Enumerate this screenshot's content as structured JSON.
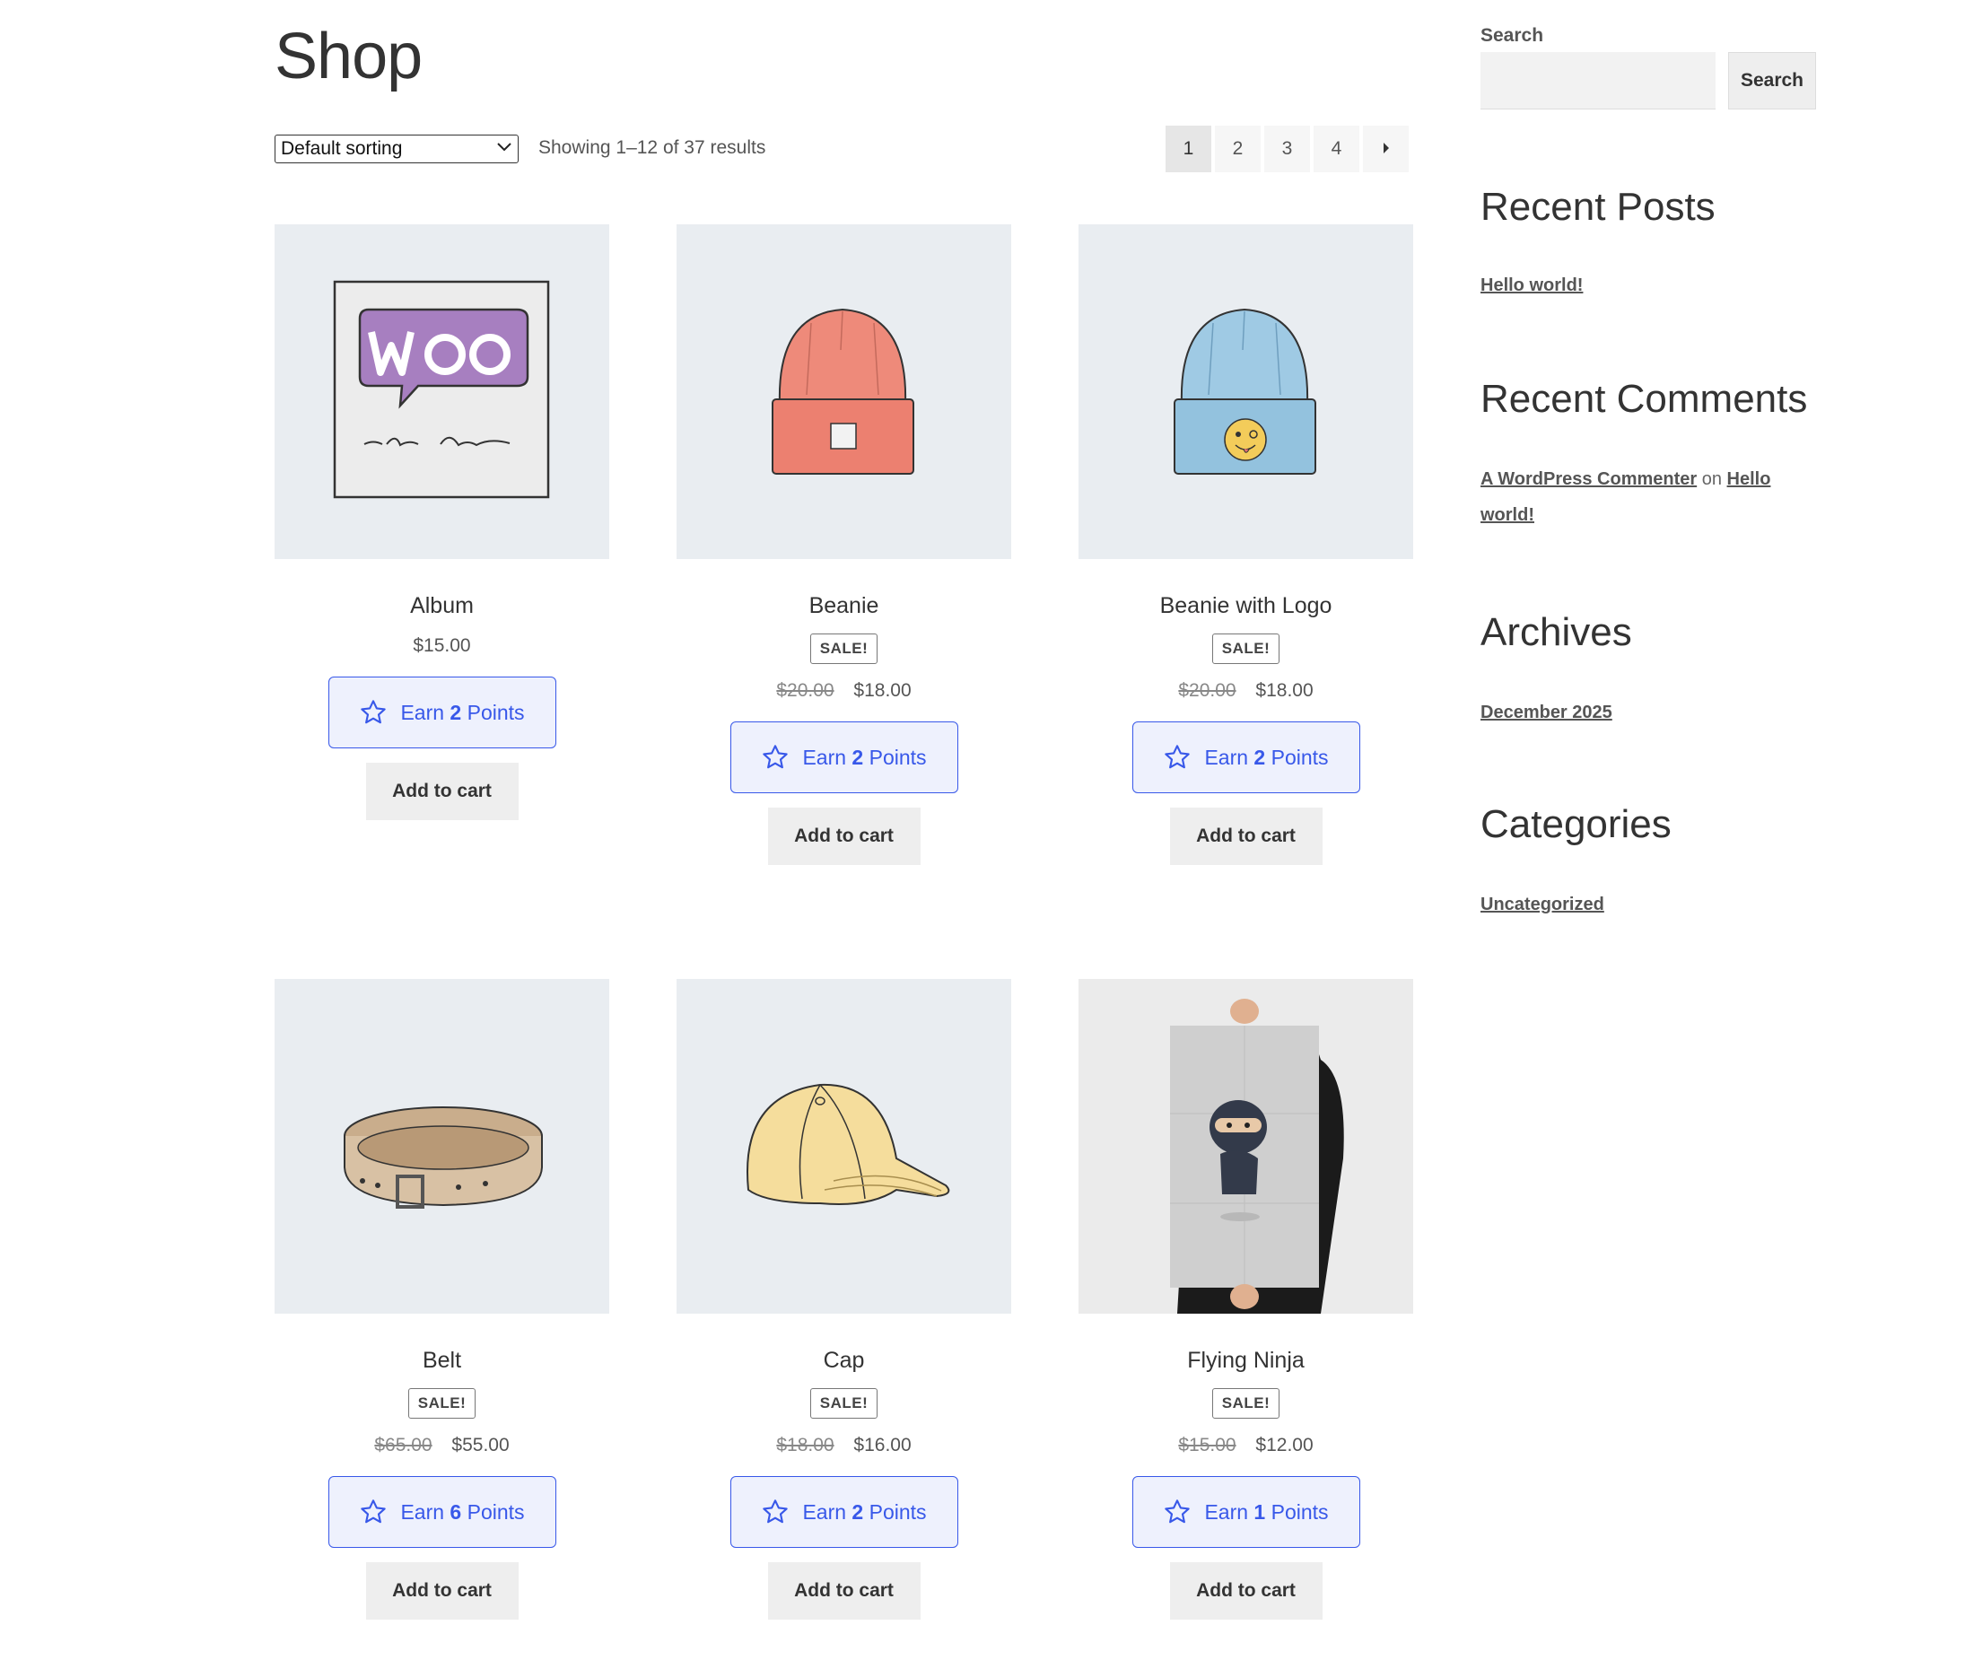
{
  "page": {
    "title": "Shop"
  },
  "toolbar": {
    "sorting": "Default sorting",
    "result_count": "Showing 1–12 of 37 results",
    "pages": [
      "1",
      "2",
      "3",
      "4"
    ],
    "current_page": "1"
  },
  "products": [
    {
      "name": "Album",
      "sale": "",
      "old_price": "",
      "price": "$15.00",
      "earn_prefix": "Earn",
      "points": "2",
      "earn_suffix": "Points",
      "cart": "Add to cart",
      "image": "woo-album"
    },
    {
      "name": "Beanie",
      "sale": "SALE!",
      "old_price": "$20.00",
      "price": "$18.00",
      "earn_prefix": "Earn",
      "points": "2",
      "earn_suffix": "Points",
      "cart": "Add to cart",
      "image": "red-beanie"
    },
    {
      "name": "Beanie with Logo",
      "sale": "SALE!",
      "old_price": "$20.00",
      "price": "$18.00",
      "earn_prefix": "Earn",
      "points": "2",
      "earn_suffix": "Points",
      "cart": "Add to cart",
      "image": "blue-beanie-logo"
    },
    {
      "name": "Belt",
      "sale": "SALE!",
      "old_price": "$65.00",
      "price": "$55.00",
      "earn_prefix": "Earn",
      "points": "6",
      "earn_suffix": "Points",
      "cart": "Add to cart",
      "image": "belt"
    },
    {
      "name": "Cap",
      "sale": "SALE!",
      "old_price": "$18.00",
      "price": "$16.00",
      "earn_prefix": "Earn",
      "points": "2",
      "earn_suffix": "Points",
      "cart": "Add to cart",
      "image": "cap"
    },
    {
      "name": "Flying Ninja",
      "sale": "SALE!",
      "old_price": "$15.00",
      "price": "$12.00",
      "earn_prefix": "Earn",
      "points": "1",
      "earn_suffix": "Points",
      "cart": "Add to cart",
      "image": "ninja-poster"
    }
  ],
  "sidebar": {
    "search_label": "Search",
    "search_button": "Search",
    "recent_posts_title": "Recent Posts",
    "recent_posts": [
      "Hello world!"
    ],
    "recent_comments_title": "Recent Comments",
    "comment_author": "A WordPress Commenter",
    "comment_on": "on",
    "comment_post_1": "Hello",
    "comment_post_2": "world!",
    "archives_title": "Archives",
    "archives": [
      "December 2025"
    ],
    "categories_title": "Categories",
    "categories": [
      "Uncategorized"
    ]
  },
  "colors": {
    "accent": "#3858e9",
    "earn_bg": "#eef1fd",
    "thumb_bg": "#e9edf1"
  }
}
